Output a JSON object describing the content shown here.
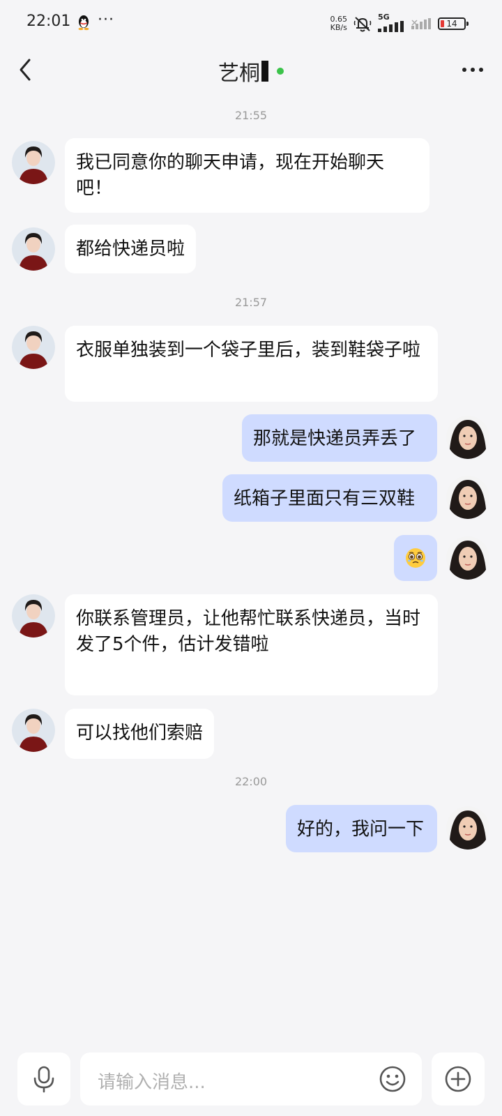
{
  "status_bar": {
    "time": "22:01",
    "more": "···",
    "speed_value": "0.65",
    "speed_unit": "KB/s",
    "network": "5G",
    "battery": "14"
  },
  "header": {
    "title": "艺桐",
    "back_icon": "chevron-left-icon",
    "more_icon": "more-horizontal-icon",
    "online_color": "#3bc34a"
  },
  "timestamps": [
    "21:55",
    "21:57",
    "22:00"
  ],
  "messages": [
    {
      "side": "left",
      "text": "我已同意你的聊天申请，现在开始聊天吧！"
    },
    {
      "side": "left",
      "text": "都给快递员啦"
    },
    {
      "side": "left",
      "text": "衣服单独装到一个袋子里后，装到鞋袋子啦"
    },
    {
      "side": "right",
      "text": "那就是快递员弄丢了"
    },
    {
      "side": "right",
      "text": "纸箱子里面只有三双鞋"
    },
    {
      "side": "right",
      "text": "",
      "emoji": "pleading-face-emoji"
    },
    {
      "side": "left",
      "text": "你联系管理员，让他帮忙联系快递员，当时发了5个件，估计发错啦"
    },
    {
      "side": "left",
      "text": "可以找他们索赔"
    },
    {
      "side": "right",
      "text": "好的，我问一下"
    }
  ],
  "input_bar": {
    "placeholder": "请输入消息...",
    "voice_icon": "microphone-icon",
    "emoji_icon": "smile-icon",
    "add_icon": "plus-circle-icon"
  },
  "colors": {
    "background": "#f5f5f7",
    "incoming_bubble": "#ffffff",
    "outgoing_bubble": "#cfdbff"
  }
}
